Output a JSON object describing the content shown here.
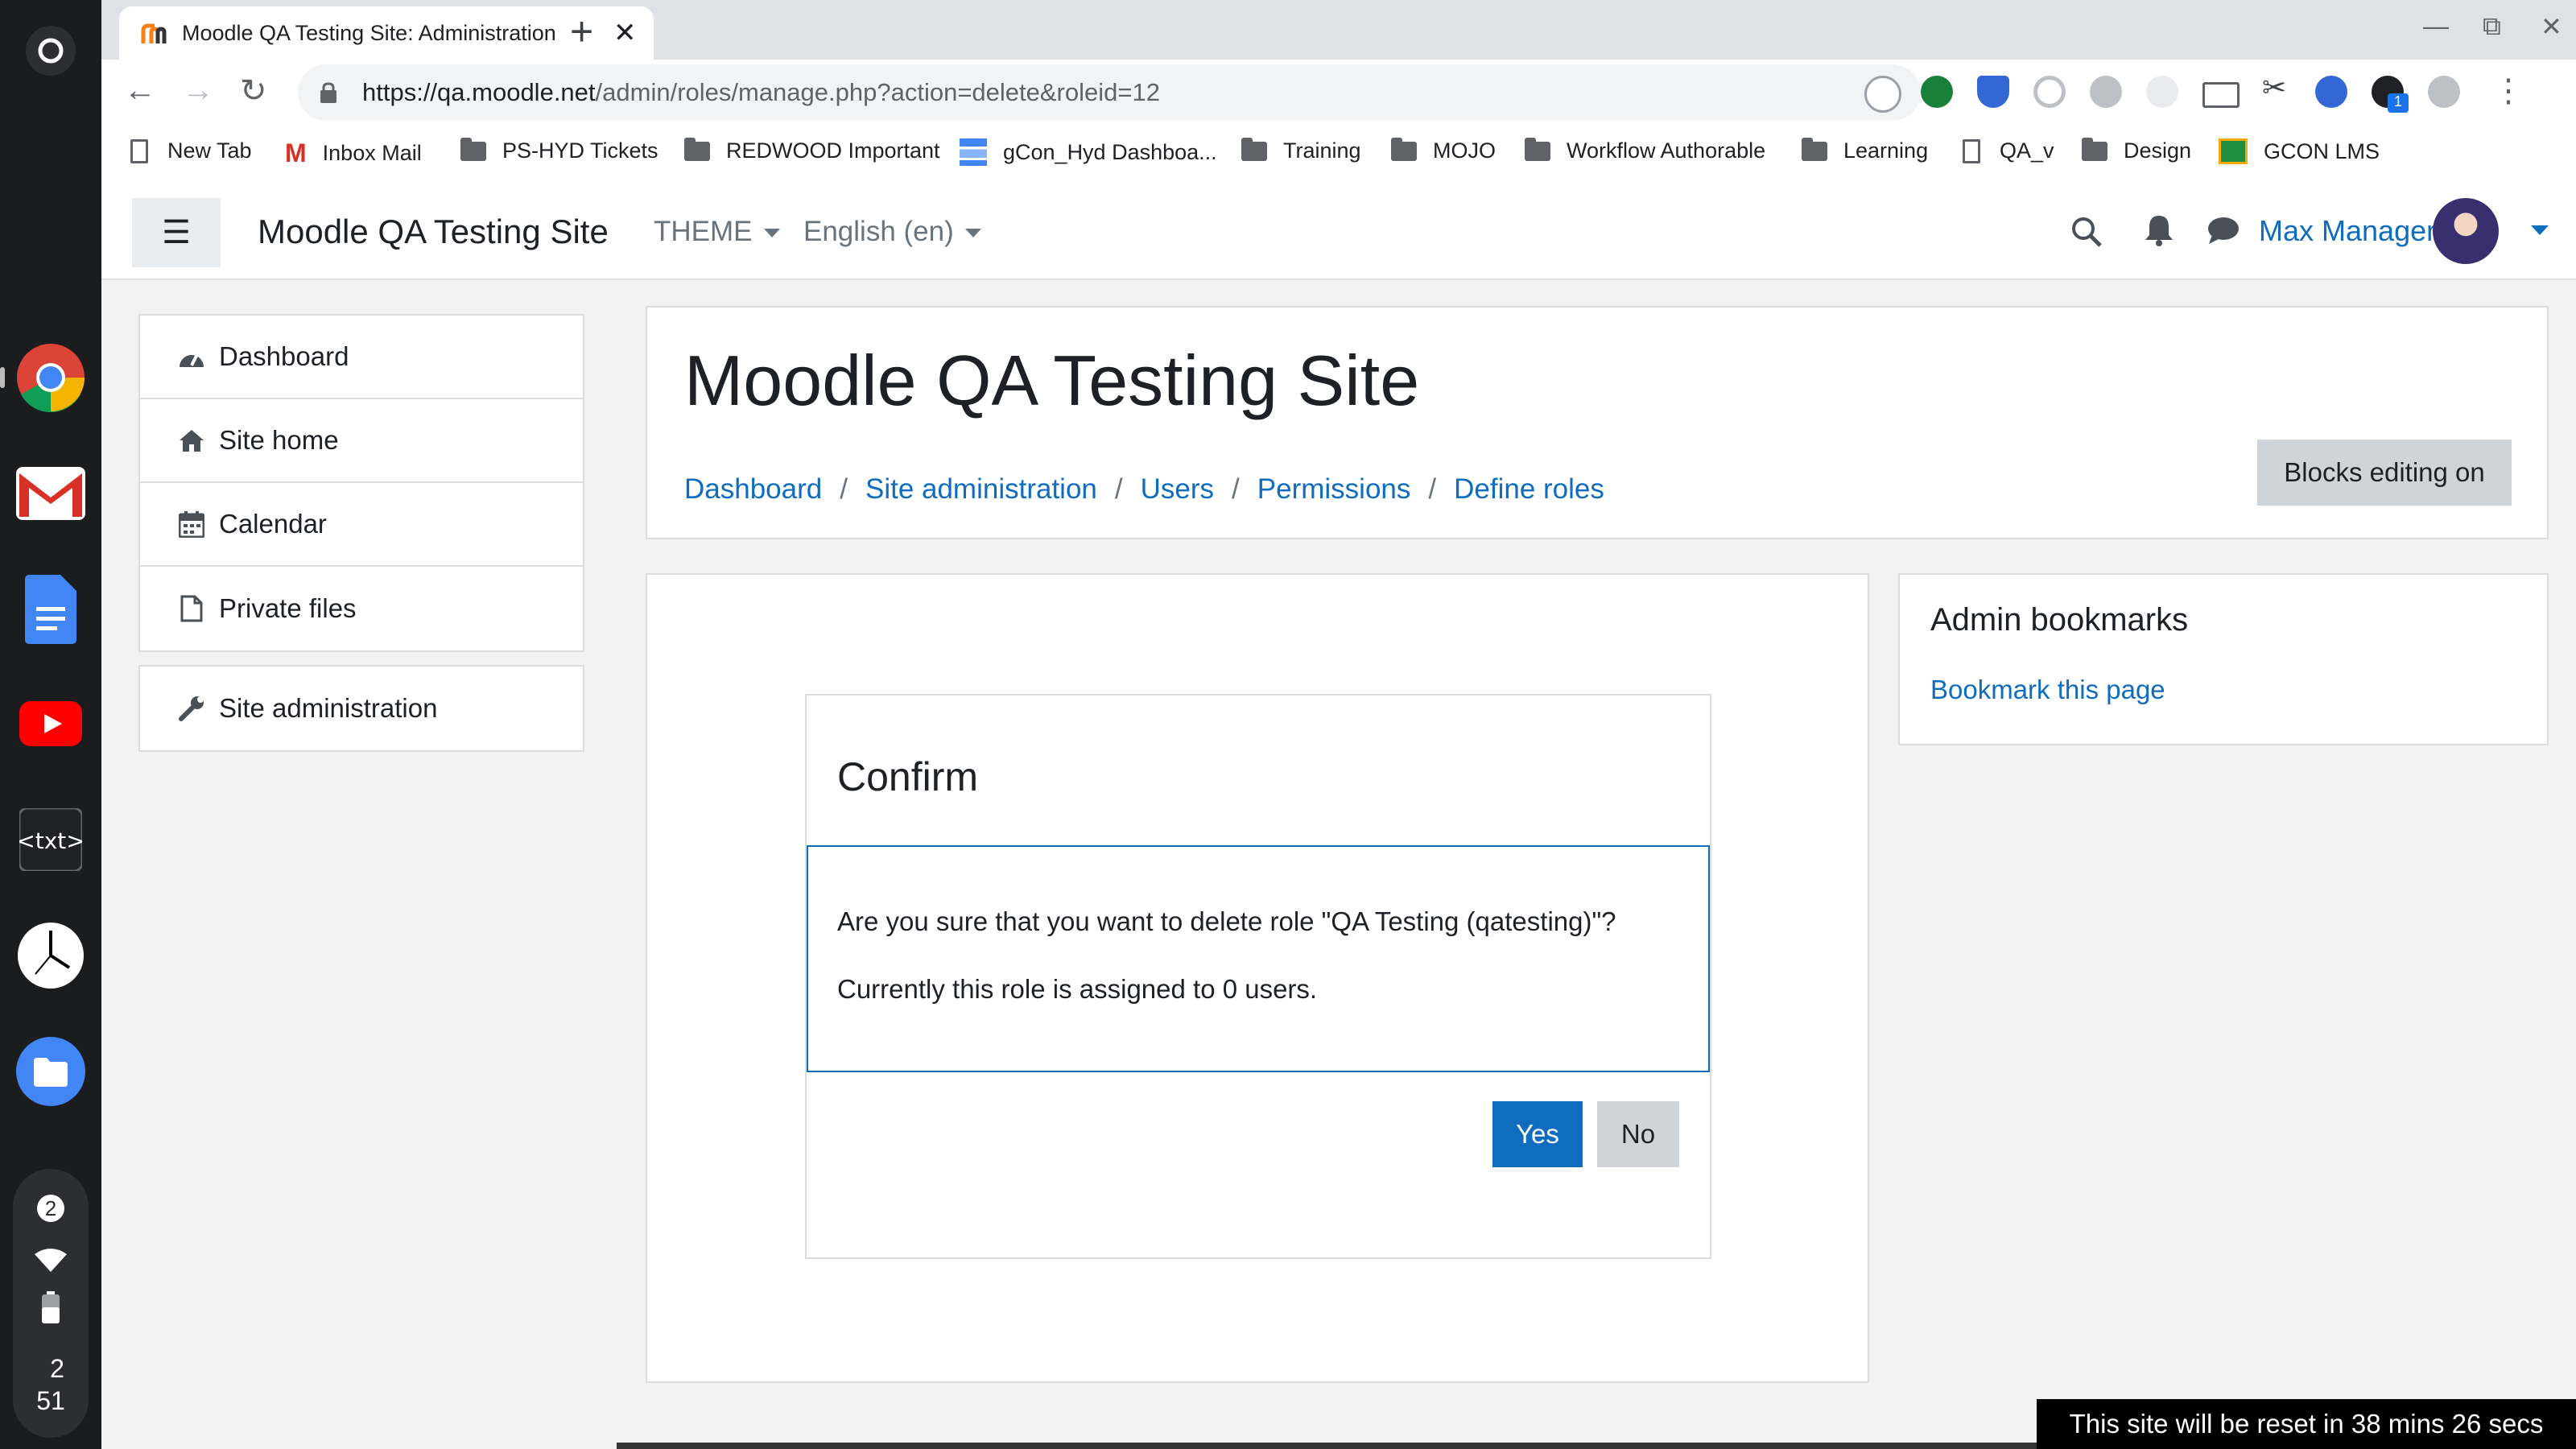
{
  "browser": {
    "tab_title": "Moodle QA Testing Site: Administration",
    "tab_close": "✕",
    "new_tab": "+",
    "url_host": "https://qa.moodle.net",
    "url_path": "/admin/roles/manage.php?action=delete&roleid=12",
    "extension_badge": "1",
    "bookmarks": [
      {
        "label": "New Tab",
        "icon": "page-icon"
      },
      {
        "label": "Inbox Mail",
        "icon": "gmail-icon"
      },
      {
        "label": "PS-HYD Tickets",
        "icon": "folder-icon"
      },
      {
        "label": "REDWOOD Important",
        "icon": "folder-icon"
      },
      {
        "label": "gCon_Hyd Dashboa...",
        "icon": "dashboard-icon"
      },
      {
        "label": "Training",
        "icon": "folder-icon"
      },
      {
        "label": "MOJO",
        "icon": "folder-icon"
      },
      {
        "label": "Workflow Authorable",
        "icon": "folder-icon"
      },
      {
        "label": "Learning",
        "icon": "folder-icon"
      },
      {
        "label": "QA_v",
        "icon": "page-icon"
      },
      {
        "label": "Design",
        "icon": "folder-icon"
      },
      {
        "label": "GCON LMS",
        "icon": "classroom-icon"
      }
    ]
  },
  "shelf": {
    "notification_count": "2",
    "clock_hour": "2",
    "clock_minute": "51"
  },
  "navbar": {
    "site_name": "Moodle QA Testing Site",
    "theme_menu": "THEME",
    "language_menu": "English (en)",
    "user_name": "Max Manager"
  },
  "drawer": {
    "items": [
      {
        "label": "Dashboard",
        "icon": "dashboard-icon"
      },
      {
        "label": "Site home",
        "icon": "home-icon"
      },
      {
        "label": "Calendar",
        "icon": "calendar-icon"
      },
      {
        "label": "Private files",
        "icon": "file-icon"
      }
    ],
    "admin_item": {
      "label": "Site administration",
      "icon": "wrench-icon"
    }
  },
  "header": {
    "title": "Moodle QA Testing Site",
    "breadcrumb": [
      "Dashboard",
      "Site administration",
      "Users",
      "Permissions",
      "Define roles"
    ],
    "separator": "/",
    "blocks_editing": "Blocks editing on"
  },
  "confirm": {
    "title": "Confirm",
    "question": "Are you sure that you want to delete role \"QA Testing (qatesting)\"?",
    "assigned": "Currently this role is assigned to 0 users.",
    "yes": "Yes",
    "no": "No"
  },
  "admin_bookmarks": {
    "title": "Admin bookmarks",
    "link": "Bookmark this page"
  },
  "reset_notice": "This site will be reset in 38 mins 26 secs",
  "colors": {
    "link": "#0f6cbf",
    "primary_button": "#0f6cbf",
    "secondary_button": "#ced4da",
    "page_background": "#f2f2f2"
  }
}
